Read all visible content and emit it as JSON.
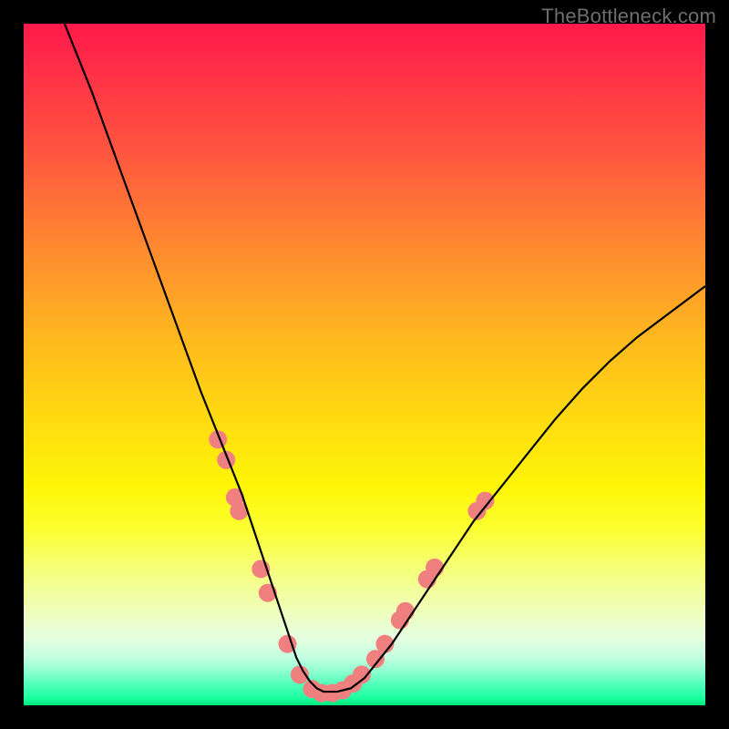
{
  "watermark": "TheBottleneck.com",
  "chart_data": {
    "type": "line",
    "title": "",
    "xlabel": "",
    "ylabel": "",
    "xlim": [
      0,
      100
    ],
    "ylim": [
      0,
      100
    ],
    "curve": {
      "x": [
        6,
        10,
        14,
        18,
        22,
        26,
        30,
        32,
        34,
        36,
        37,
        38,
        39,
        40,
        41,
        42,
        43,
        44,
        46,
        48,
        50,
        54,
        58,
        62,
        66,
        70,
        74,
        78,
        82,
        86,
        90,
        94,
        98,
        100
      ],
      "y": [
        100,
        90,
        79,
        68,
        57,
        46,
        36,
        31,
        25,
        19,
        16,
        13,
        10,
        7,
        5,
        3.5,
        2.5,
        2,
        2,
        2.5,
        4,
        9,
        15,
        21,
        27,
        32,
        37,
        42,
        46.5,
        50.5,
        54,
        57,
        60,
        61.5
      ]
    },
    "markers": {
      "color": "#f08080",
      "radius": 10,
      "points": [
        {
          "x": 28.5,
          "y": 39
        },
        {
          "x": 29.7,
          "y": 36
        },
        {
          "x": 31.0,
          "y": 30.5
        },
        {
          "x": 31.6,
          "y": 28.5
        },
        {
          "x": 34.8,
          "y": 20
        },
        {
          "x": 35.8,
          "y": 16.5
        },
        {
          "x": 38.7,
          "y": 9
        },
        {
          "x": 40.5,
          "y": 4.5
        },
        {
          "x": 42.3,
          "y": 2.4
        },
        {
          "x": 43.7,
          "y": 1.8
        },
        {
          "x": 45.3,
          "y": 1.8
        },
        {
          "x": 46.8,
          "y": 2.2
        },
        {
          "x": 48.3,
          "y": 3.2
        },
        {
          "x": 49.6,
          "y": 4.5
        },
        {
          "x": 51.6,
          "y": 6.8
        },
        {
          "x": 53.0,
          "y": 9
        },
        {
          "x": 55.2,
          "y": 12.5
        },
        {
          "x": 56.0,
          "y": 13.8
        },
        {
          "x": 59.2,
          "y": 18.5
        },
        {
          "x": 60.3,
          "y": 20.2
        },
        {
          "x": 66.5,
          "y": 28.5
        },
        {
          "x": 67.7,
          "y": 30
        }
      ]
    }
  }
}
